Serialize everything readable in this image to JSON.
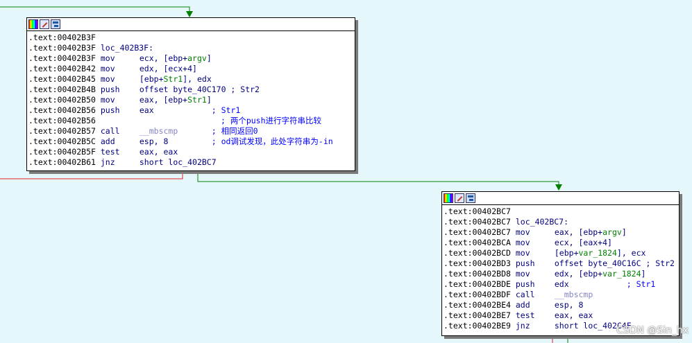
{
  "colors": {
    "background": "#e6f7fb",
    "edge_true": "#008000",
    "edge_false": "#e02020",
    "address": "#000000",
    "instruction": "#000080",
    "variable": "#008000",
    "function": "#8484c6",
    "comment": "#0000ff"
  },
  "icons": [
    "color-palette-icon",
    "rename-pencil-icon",
    "graph-overview-icon"
  ],
  "watermark": "CSDN @Sin_hx",
  "blocks": [
    {
      "id": "block-402b3f",
      "lines": [
        {
          "addr": ".text:00402B3F"
        },
        {
          "addr": ".text:00402B3F",
          "label": "loc_402B3F:"
        },
        {
          "addr": ".text:00402B3F",
          "mnem": "mov",
          "ops": [
            {
              "t": "ecx, [ebp+"
            },
            {
              "t": "argv",
              "c": "var"
            },
            {
              "t": "]"
            }
          ]
        },
        {
          "addr": ".text:00402B42",
          "mnem": "mov",
          "ops": [
            {
              "t": "edx, [ecx+4]"
            }
          ]
        },
        {
          "addr": ".text:00402B45",
          "mnem": "mov",
          "ops": [
            {
              "t": "[ebp+"
            },
            {
              "t": "Str1",
              "c": "var"
            },
            {
              "t": "], edx"
            }
          ]
        },
        {
          "addr": ".text:00402B4B",
          "mnem": "push",
          "ops": [
            {
              "t": "offset byte_40C170 ; Str2"
            }
          ]
        },
        {
          "addr": ".text:00402B50",
          "mnem": "mov",
          "ops": [
            {
              "t": "eax, [ebp+"
            },
            {
              "t": "Str1",
              "c": "var"
            },
            {
              "t": "]"
            }
          ]
        },
        {
          "addr": ".text:00402B56",
          "mnem": "push",
          "ops": [
            {
              "t": "eax            "
            },
            {
              "t": "; Str1",
              "c": "cmt"
            }
          ]
        },
        {
          "addr": ".text:00402B56",
          "ops": [
            {
              "t": "                         "
            },
            {
              "t": "; 两个push进行字符串比较",
              "c": "cmt"
            }
          ]
        },
        {
          "addr": ".text:00402B57",
          "mnem": "call",
          "ops": [
            {
              "t": "__mbscmp",
              "c": "fn"
            },
            {
              "t": "       "
            },
            {
              "t": "; 相同返回0",
              "c": "cmt"
            }
          ]
        },
        {
          "addr": ".text:00402B5C",
          "mnem": "add",
          "ops": [
            {
              "t": "esp, 8         "
            },
            {
              "t": "; od调试发现，此处字符串为-in",
              "c": "cmt"
            }
          ]
        },
        {
          "addr": ".text:00402B5F",
          "mnem": "test",
          "ops": [
            {
              "t": "eax, eax"
            }
          ]
        },
        {
          "addr": ".text:00402B61",
          "mnem": "jnz",
          "ops": [
            {
              "t": "short loc_402BC7"
            }
          ]
        }
      ]
    },
    {
      "id": "block-402bc7",
      "lines": [
        {
          "addr": ".text:00402BC7"
        },
        {
          "addr": ".text:00402BC7",
          "label": "loc_402BC7:"
        },
        {
          "addr": ".text:00402BC7",
          "mnem": "mov",
          "ops": [
            {
              "t": "eax, [ebp+"
            },
            {
              "t": "argv",
              "c": "var"
            },
            {
              "t": "]"
            }
          ]
        },
        {
          "addr": ".text:00402BCA",
          "mnem": "mov",
          "ops": [
            {
              "t": "ecx, [eax+4]"
            }
          ]
        },
        {
          "addr": ".text:00402BCD",
          "mnem": "mov",
          "ops": [
            {
              "t": "[ebp+"
            },
            {
              "t": "var_1824",
              "c": "var"
            },
            {
              "t": "], ecx"
            }
          ]
        },
        {
          "addr": ".text:00402BD3",
          "mnem": "push",
          "ops": [
            {
              "t": "offset byte_40C16C ; Str2"
            }
          ]
        },
        {
          "addr": ".text:00402BD8",
          "mnem": "mov",
          "ops": [
            {
              "t": "edx, [ebp+"
            },
            {
              "t": "var_1824",
              "c": "var"
            },
            {
              "t": "]"
            }
          ]
        },
        {
          "addr": ".text:00402BDE",
          "mnem": "push",
          "ops": [
            {
              "t": "edx            "
            },
            {
              "t": "; Str1",
              "c": "cmt"
            }
          ]
        },
        {
          "addr": ".text:00402BDF",
          "mnem": "call",
          "ops": [
            {
              "t": "__mbscmp",
              "c": "fn"
            }
          ]
        },
        {
          "addr": ".text:00402BE4",
          "mnem": "add",
          "ops": [
            {
              "t": "esp, 8"
            }
          ]
        },
        {
          "addr": ".text:00402BE7",
          "mnem": "test",
          "ops": [
            {
              "t": "eax, eax"
            }
          ]
        },
        {
          "addr": ".text:00402BE9",
          "mnem": "jnz",
          "ops": [
            {
              "t": "short loc_402C4F"
            }
          ]
        }
      ]
    }
  ]
}
